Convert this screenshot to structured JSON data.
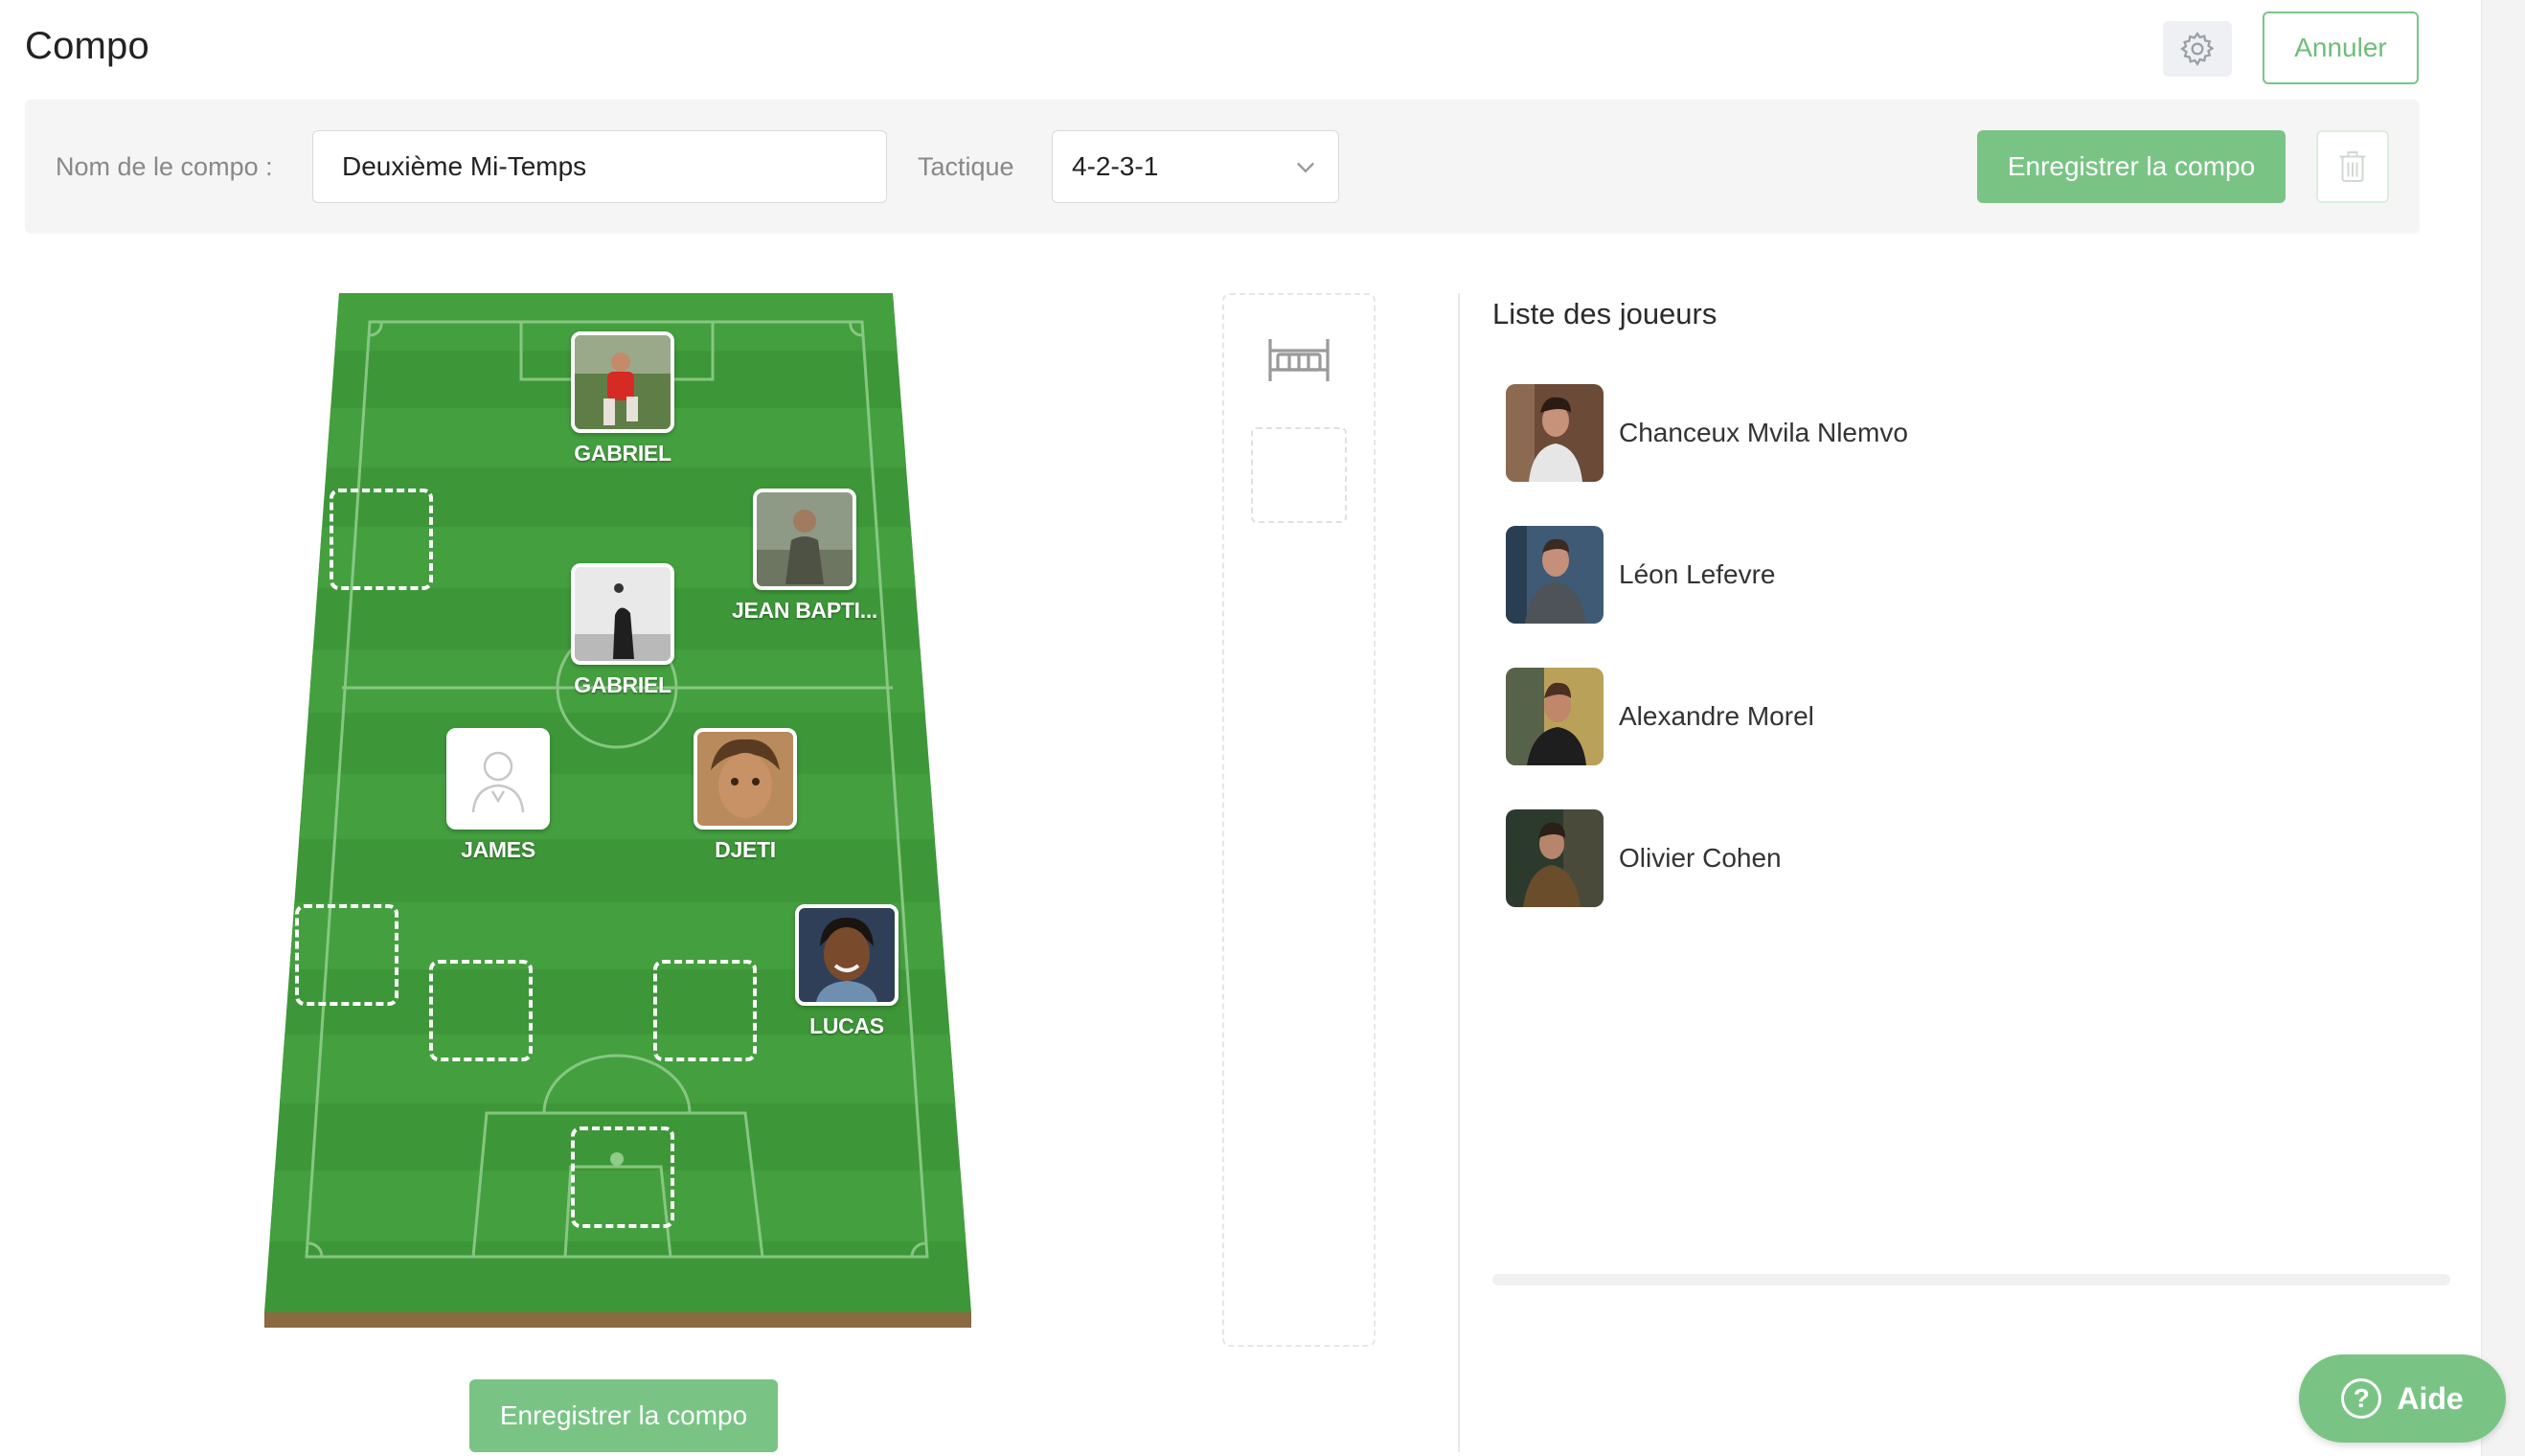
{
  "header": {
    "title": "Compo",
    "cancel_label": "Annuler",
    "gear_icon": "gear-icon"
  },
  "form": {
    "name_label": "Nom de le compo :",
    "name_value": "Deuxième Mi-Temps",
    "tactic_label": "Tactique",
    "tactic_value": "4-2-3-1",
    "save_label": "Enregistrer la compo",
    "trash_icon": "trash-icon"
  },
  "lineup": [
    {
      "name": "GABRIEL",
      "photo": "striker-red"
    },
    {
      "name": "JEAN BAPTI...",
      "photo": "man-outdoor"
    },
    {
      "name": "GABRIEL",
      "photo": "player-bw"
    },
    {
      "name": "JAMES",
      "photo": "placeholder"
    },
    {
      "name": "DJETI",
      "photo": "child"
    },
    {
      "name": "LUCAS",
      "photo": "smiling-man"
    }
  ],
  "bench": {
    "icon": "bed-icon"
  },
  "players_list": {
    "title": "Liste des joueurs",
    "players": [
      {
        "name": "Chanceux Mvila Nlemvo"
      },
      {
        "name": "Léon Lefevre"
      },
      {
        "name": "Alexandre Morel"
      },
      {
        "name": "Olivier Cohen"
      }
    ]
  },
  "bottom": {
    "save_label": "Enregistrer la compo"
  },
  "help": {
    "label": "Aide"
  },
  "colors": {
    "accent": "#79c485",
    "pitch_light": "#3f9a3b",
    "pitch_dark": "#348a31"
  }
}
